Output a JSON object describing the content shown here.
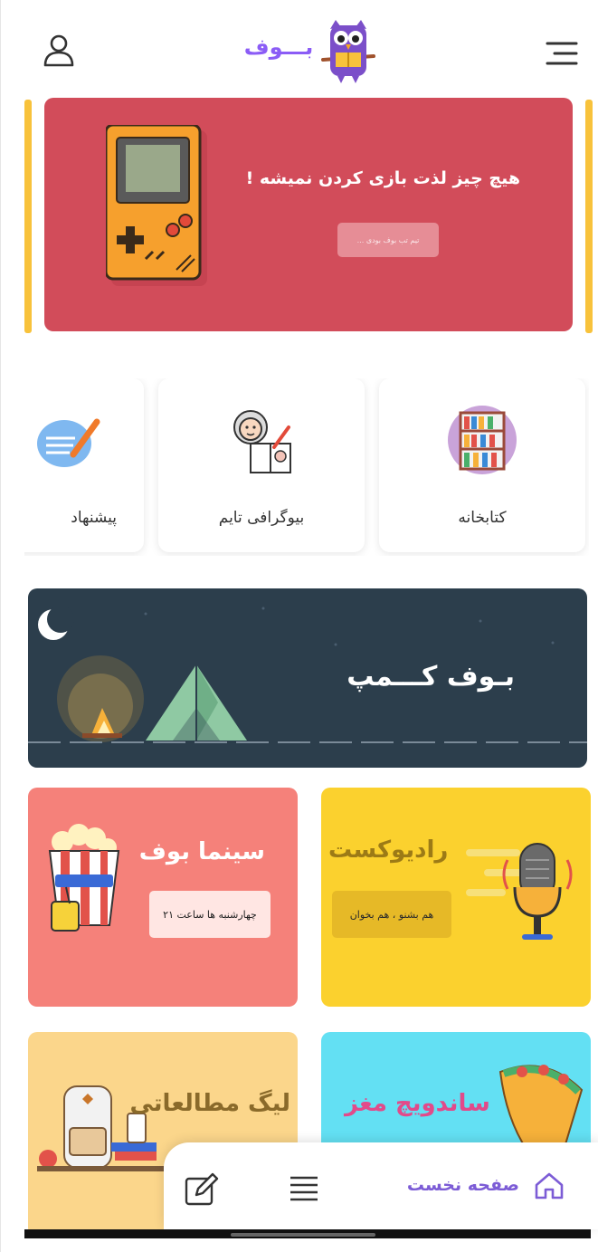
{
  "header": {
    "logo_text": "بـــوف"
  },
  "hero": {
    "title": "هیچ چیز لذت بازی کردن نمیشه !",
    "button_label": "تیم تب بوف بودی ..."
  },
  "categories": [
    {
      "label": "کتابخانه",
      "icon": "bookshelf-icon"
    },
    {
      "label": "بیوگرافی تایم",
      "icon": "writer-icon"
    },
    {
      "label": "پیشنهاد",
      "icon": "note-pencil-icon"
    }
  ],
  "camp": {
    "title": "بـوف کـــمپ"
  },
  "tiles": {
    "cinema": {
      "title": "سینما بوف",
      "subtitle": "چهارشنبه ها ساعت ۲۱"
    },
    "radio": {
      "title": "رادیوکست",
      "subtitle": "هم بشنو ، هم بخوان"
    },
    "league": {
      "title": "لیگ مطالعاتی"
    },
    "sandwich": {
      "title": "ساندویچ مغز"
    }
  },
  "bottom_nav": {
    "home_label": "صفحه نخست"
  },
  "colors": {
    "brand_purple": "#8b5cf6",
    "hero_red": "#d24c5a",
    "camp_navy": "#2c3e4c",
    "cinema_salmon": "#f5817a",
    "radio_yellow": "#fbd12e",
    "league_cream": "#fbd68b",
    "sandwich_cyan": "#63e0f3"
  }
}
